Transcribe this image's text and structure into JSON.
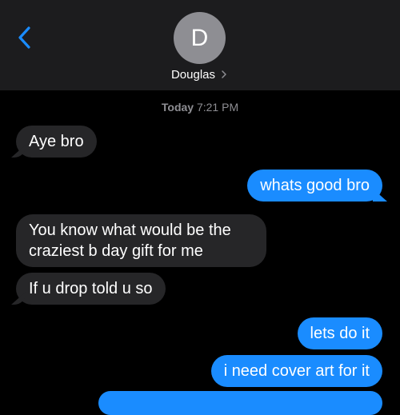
{
  "header": {
    "back_icon": "chevron-left-icon",
    "avatar_initial": "D",
    "contact_name": "Douglas",
    "accent": "#1a8cff"
  },
  "timestamp": {
    "day": "Today",
    "time": "7:21 PM"
  },
  "messages": [
    {
      "direction": "incoming",
      "text": "Aye bro"
    },
    {
      "direction": "outgoing",
      "text": "whats good bro"
    },
    {
      "direction": "incoming",
      "lines": [
        "You know what would be the",
        "craziest b day gift for me"
      ]
    },
    {
      "direction": "incoming",
      "text": "If u drop told u so"
    },
    {
      "direction": "outgoing",
      "text": "lets do it"
    },
    {
      "direction": "outgoing",
      "text": "i need cover art for it"
    }
  ]
}
